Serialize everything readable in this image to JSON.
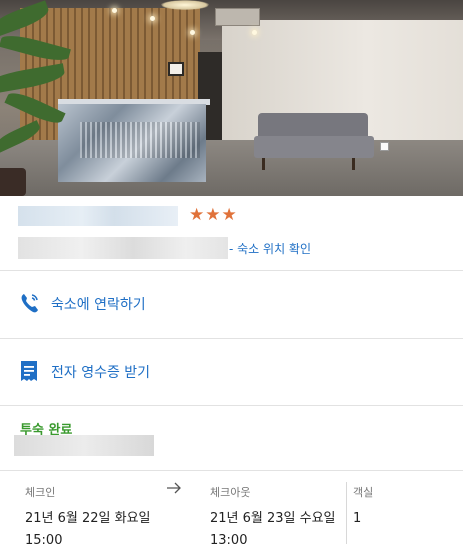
{
  "hotel": {
    "stars": "★★★",
    "map_link": "- 숙소 위치 확인"
  },
  "actions": {
    "contact": {
      "label": "숙소에 연락하기",
      "icon": "phone-icon"
    },
    "receipt": {
      "label": "전자 영수증 받기",
      "icon": "receipt-icon"
    }
  },
  "booking": {
    "status": "투숙 완료",
    "checkin": {
      "title": "체크인",
      "date": "21년 6월 22일 화요일",
      "time": "15:00"
    },
    "checkout": {
      "title": "체크아웃",
      "date": "21년 6월 23일 수요일",
      "time": "13:00"
    },
    "rooms": {
      "title": "객실",
      "value": "1"
    }
  },
  "colors": {
    "accent": "#1f6fc5",
    "star": "#e0723a",
    "status": "#3a9a2e"
  }
}
